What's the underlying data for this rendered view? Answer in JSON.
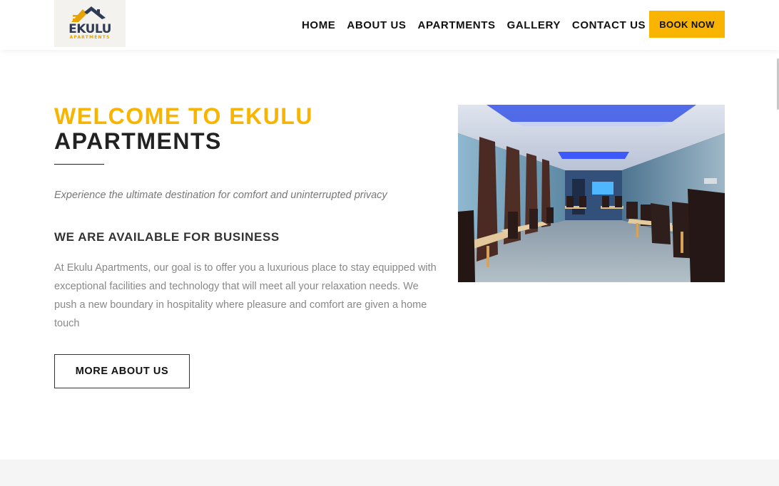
{
  "logo": {
    "word": "EKULU",
    "sub": "APARTMENTS"
  },
  "nav": {
    "items": [
      "HOME",
      "ABOUT US",
      "APARTMENTS",
      "GALLERY",
      "CONTACT US"
    ],
    "book_label": "BOOK NOW"
  },
  "welcome": {
    "title_highlight": "WELCOME TO EKULU",
    "title_rest": "APARTMENTS",
    "tagline": "Experience the ultimate destination for comfort and uninterrupted privacy",
    "subheading": "WE ARE AVAILABLE FOR BUSINESS",
    "body": "At Ekulu Apartments, our goal is to offer you a luxurious place to stay equipped with exceptional facilities and technology that will meet all your relaxation needs. We push a new boundary in hospitality where pleasure and comfort are given a home touch",
    "button_label": "MORE ABOUT US"
  },
  "colors": {
    "accent": "#f9b400",
    "text": "#222222",
    "muted": "#888888"
  }
}
